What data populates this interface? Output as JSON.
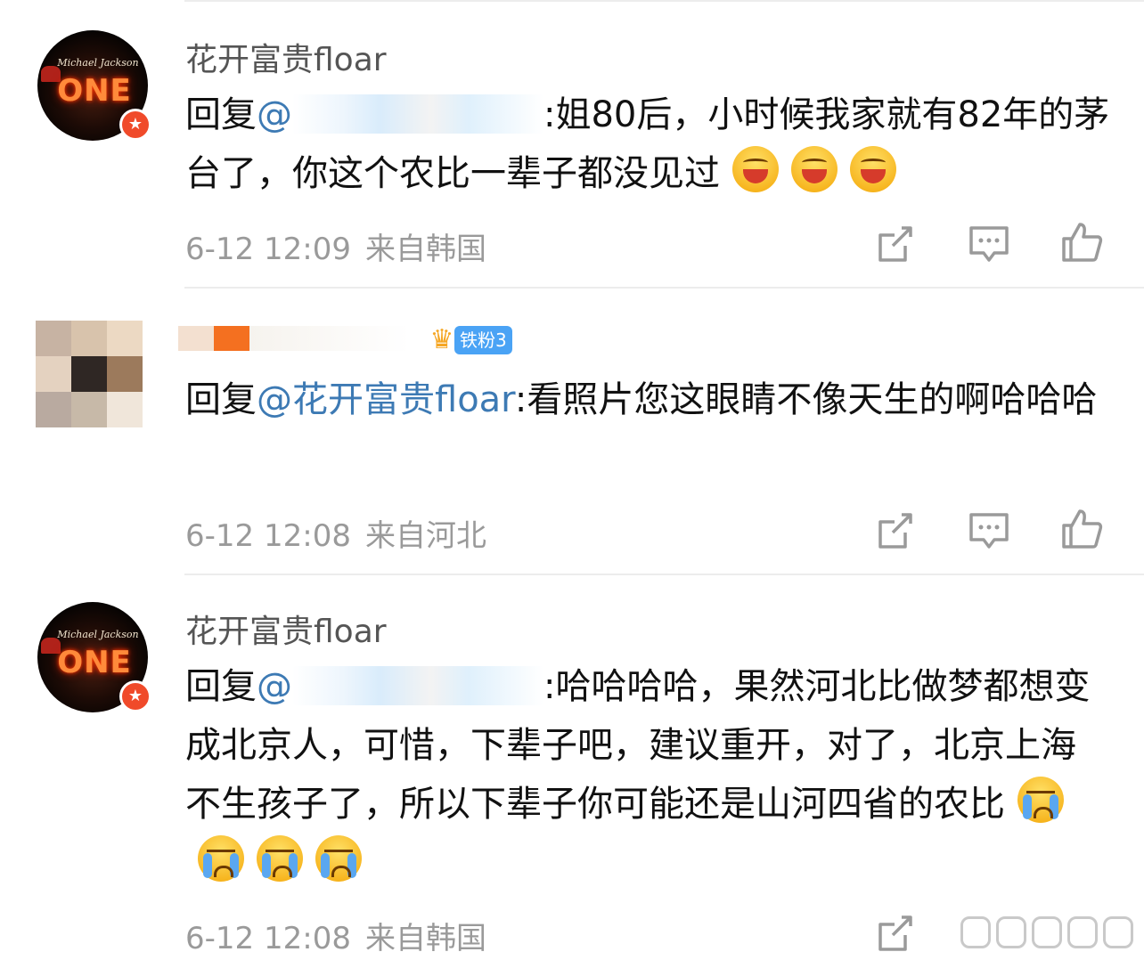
{
  "comments": [
    {
      "username": "花开富贵floar",
      "reply_prefix": "回复",
      "mention_visible": "@",
      "text": ":姐80后，小时候我家就有82年的茅台了，你这个农比一辈子都没见过",
      "emoji": [
        "grinning-face",
        "grinning-face",
        "grinning-face"
      ],
      "timestamp": "6-12 12:09",
      "location": "来自韩国"
    },
    {
      "username": "",
      "fan_badge": "铁粉3",
      "reply_prefix": "回复",
      "mention": "@花开富贵floar",
      "text": ":看照片您这眼睛不像天生的啊哈哈哈",
      "emoji": [],
      "timestamp": "6-12 12:08",
      "location": "来自河北"
    },
    {
      "username": "花开富贵floar",
      "reply_prefix": "回复",
      "mention_visible": "@",
      "text": ":哈哈哈哈，果然河北比做梦都想变成北京人，可惜，下辈子吧，建议重开，对了，北京上海不生孩子了，所以下辈子你可能还是山河四省的农比",
      "emoji": [
        "crying-face",
        "crying-face",
        "crying-face",
        "crying-face"
      ],
      "timestamp": "6-12 12:08",
      "location": "来自韩国"
    }
  ],
  "avatar": {
    "script_text": "Michael Jackson",
    "logo_text": "ONE",
    "verified_icon": "star-badge-icon"
  },
  "actions": [
    "share-icon",
    "comment-icon",
    "like-icon"
  ],
  "colors": {
    "mention": "#3d7ab4",
    "meta": "#9a9a9a",
    "fan_badge": "#4aa3f5",
    "verified_badge": "#f04a2a"
  }
}
